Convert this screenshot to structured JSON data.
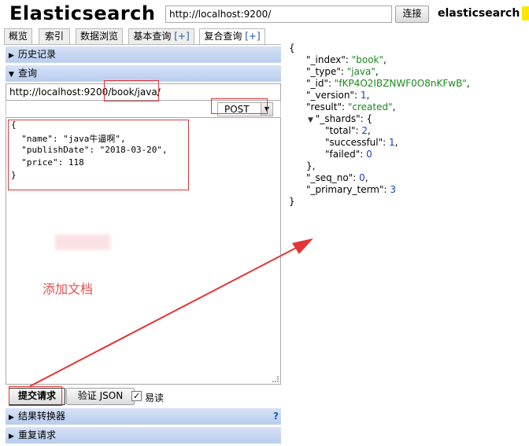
{
  "app": {
    "title": "Elasticsearch",
    "connection_url": "http://localhost:9200/",
    "connect_label": "连接",
    "cluster_name": "elasticsearch",
    "cluster_status_color": "#ffe600"
  },
  "tabs": [
    {
      "label": "概览",
      "plus": ""
    },
    {
      "label": "索引",
      "plus": ""
    },
    {
      "label": "数据浏览",
      "plus": ""
    },
    {
      "label": "基本查询 ",
      "plus": "[+]"
    },
    {
      "label": "复合查询 ",
      "plus": "[+]"
    }
  ],
  "sections": {
    "history": "历史记录",
    "query": "查询",
    "result_transformer": "结果转换器",
    "repeat_request": "重复请求",
    "help": "?"
  },
  "request": {
    "base_url": "http://localhost:9200/",
    "path": "book/java/",
    "method": "POST",
    "body_lines": [
      "{",
      "  \"name\": \"java牛逼啊\",",
      "  \"publishDate\": \"2018-03-20\",",
      "  \"price\": 118",
      "}"
    ],
    "submit_label": "提交请求",
    "validate_label": "验证 JSON",
    "pretty_label": "易读",
    "pretty_checked": "✓"
  },
  "annotation": {
    "text": "添加文档",
    "color": "#e23636"
  },
  "response": {
    "index_key": "\"_index\"",
    "index_val": "\"book\"",
    "type_key": "\"_type\"",
    "type_val": "\"java\"",
    "id_key": "\"_id\"",
    "id_val": "\"fKP4O2IBZNWF0O8nKFwB\"",
    "version_key": "\"_version\"",
    "version_val": "1",
    "result_key": "\"result\"",
    "result_val": "\"created\"",
    "shards_key": "\"_shards\"",
    "total_key": "\"total\"",
    "total_val": "2",
    "successful_key": "\"successful\"",
    "successful_val": "1",
    "failed_key": "\"failed\"",
    "failed_val": "0",
    "seq_no_key": "\"_seq_no\"",
    "seq_no_val": "0",
    "primary_term_key": "\"_primary_term\"",
    "primary_term_val": "3"
  }
}
